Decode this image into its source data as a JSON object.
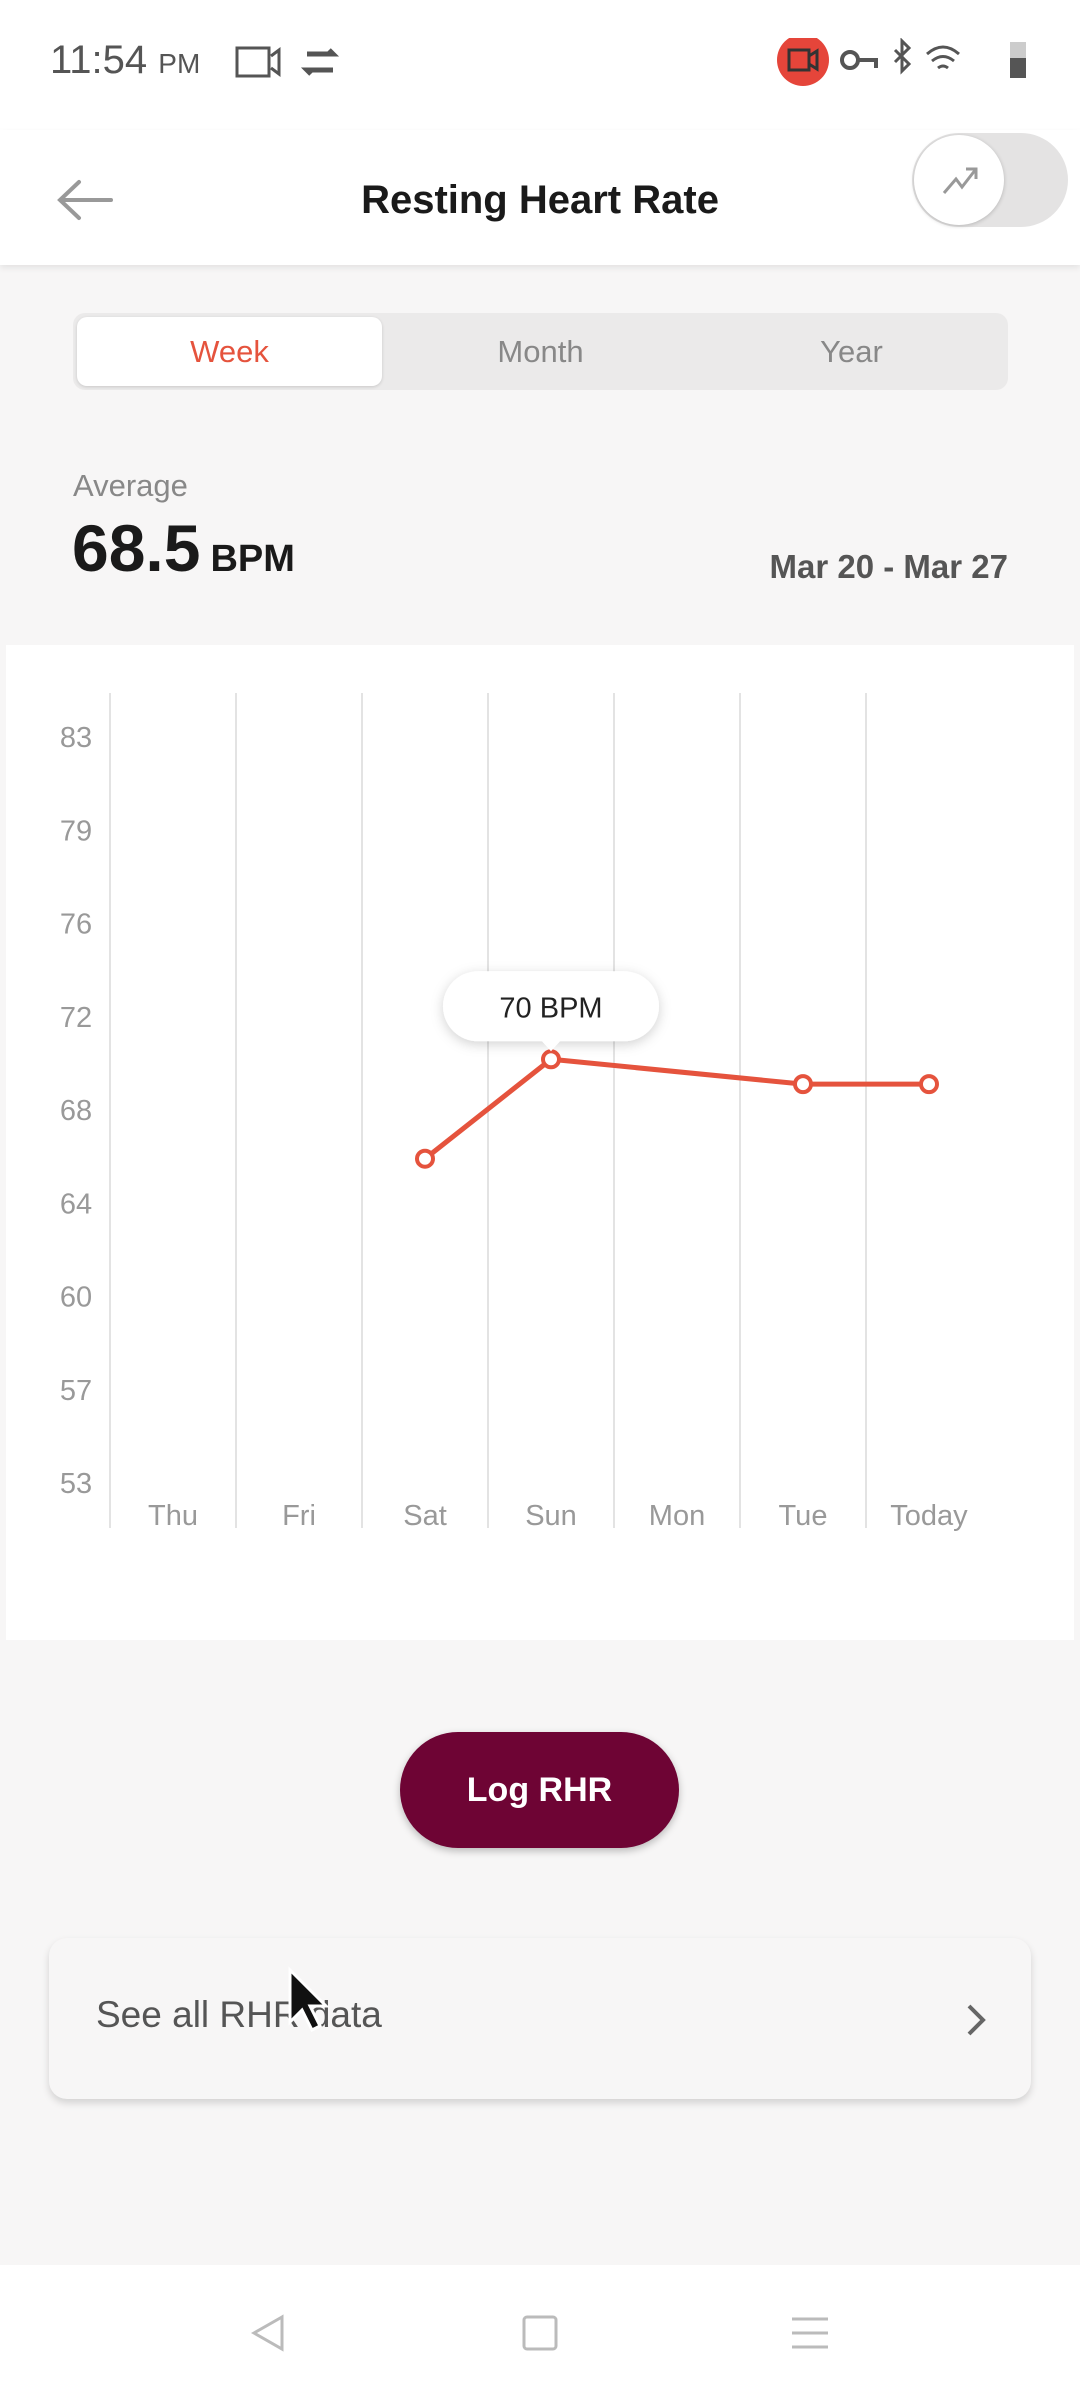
{
  "status_bar": {
    "time": "11:54",
    "ampm": "PM",
    "icons": [
      "screen-record-icon",
      "sync-icon",
      "recording-badge-icon",
      "vpn-key-icon",
      "bluetooth-icon",
      "wifi-icon",
      "battery-icon"
    ]
  },
  "header": {
    "title": "Resting Heart Rate",
    "back_icon": "arrow-left-icon",
    "toggle_icon": "trend-icon"
  },
  "tabs": [
    {
      "label": "Week",
      "active": true
    },
    {
      "label": "Month",
      "active": false
    },
    {
      "label": "Year",
      "active": false
    }
  ],
  "summary": {
    "label": "Average",
    "value": "68.5",
    "unit": "BPM",
    "date_range": "Mar 20 - Mar 27"
  },
  "colors": {
    "accent": "#e5533d",
    "button": "#6e0434"
  },
  "chart_data": {
    "type": "line",
    "categories": [
      "Thu",
      "Fri",
      "Sat",
      "Sun",
      "Mon",
      "Tue",
      "Today"
    ],
    "values": [
      null,
      null,
      66,
      70,
      null,
      69,
      69
    ],
    "yticks": [
      "83",
      "79",
      "76",
      "72",
      "68",
      "64",
      "60",
      "57",
      "53"
    ],
    "ylim": [
      53,
      83
    ],
    "grid": "vertical",
    "tooltip": {
      "category": "Sun",
      "label": "70 BPM"
    }
  },
  "actions": {
    "log_label": "Log RHR",
    "see_all_label": "See all RHR data"
  }
}
